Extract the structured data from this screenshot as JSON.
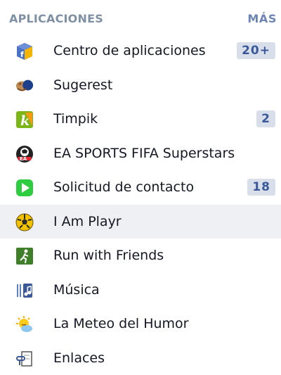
{
  "header": {
    "title": "APLICACIONES",
    "more": "MÁS"
  },
  "items": [
    {
      "label": "Centro de aplicaciones",
      "badge": "20+",
      "icon": "app-center-icon"
    },
    {
      "label": "Sugerest",
      "badge": "",
      "icon": "sugerest-icon"
    },
    {
      "label": "Timpik",
      "badge": "2",
      "icon": "timpik-icon"
    },
    {
      "label": "EA SPORTS FIFA Superstars",
      "badge": "",
      "icon": "ea-sports-icon"
    },
    {
      "label": "Solicitud de contacto",
      "badge": "18",
      "icon": "contact-request-icon"
    },
    {
      "label": "I Am Playr",
      "badge": "",
      "icon": "i-am-playr-icon",
      "selected": true
    },
    {
      "label": "Run with Friends",
      "badge": "",
      "icon": "run-with-friends-icon"
    },
    {
      "label": "Música",
      "badge": "",
      "icon": "music-icon"
    },
    {
      "label": "La Meteo del Humor",
      "badge": "",
      "icon": "weather-humor-icon"
    },
    {
      "label": "Enlaces",
      "badge": "",
      "icon": "links-icon"
    }
  ],
  "colors": {
    "header_text": "#7f8fa4",
    "more_link": "#6d84b4",
    "badge_bg": "#d8dfea",
    "badge_text": "#3b5998",
    "selected_bg": "#eff0f4"
  }
}
